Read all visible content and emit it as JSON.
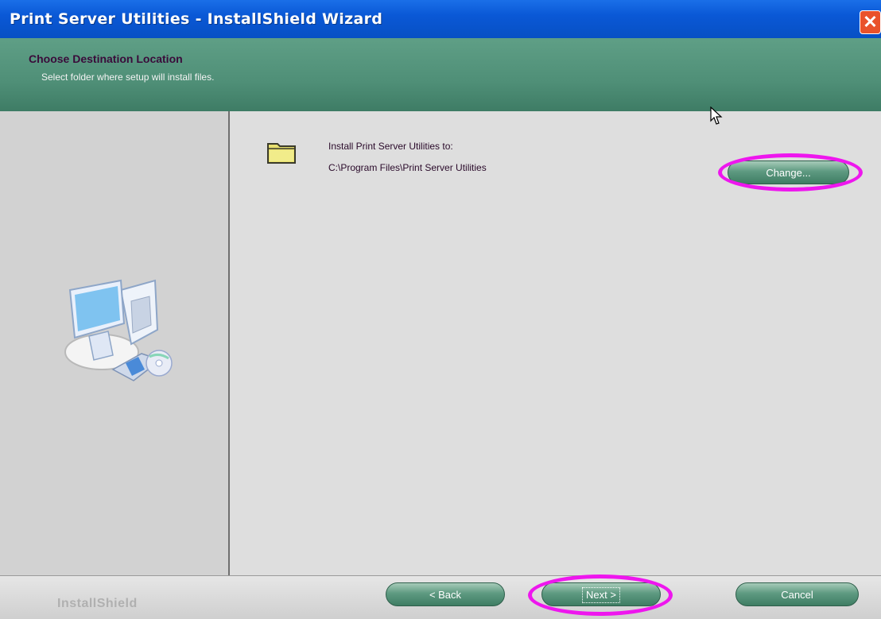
{
  "window": {
    "title": "Print Server Utilities - InstallShield Wizard",
    "close_symbol": "✕"
  },
  "header": {
    "title": "Choose Destination Location",
    "subtitle": "Select folder where setup will install files."
  },
  "content": {
    "label": "Install Print Server Utilities to:",
    "path": "C:\\Program Files\\Print Server Utilities",
    "change_button": "Change..."
  },
  "footer": {
    "brand": "InstallShield",
    "back_button": "< Back",
    "next_button": "Next >",
    "cancel_button": "Cancel"
  },
  "icons": {
    "folder": "folder-icon",
    "computer": "computer-illustration",
    "close": "close-icon",
    "cursor": "mouse-cursor-icon"
  },
  "colors": {
    "title_bar": "#0a58d6",
    "header_band": "#4f8f77",
    "highlight_ring": "#ee16ee",
    "button_green": "#3f7d63"
  }
}
